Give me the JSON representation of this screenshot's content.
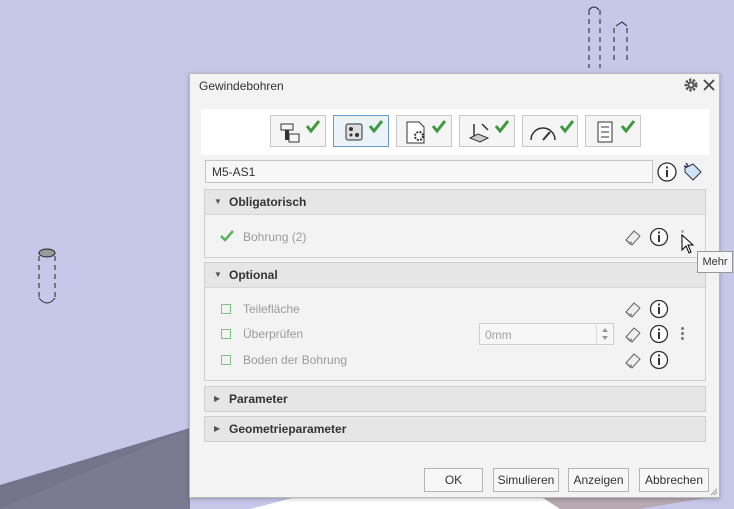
{
  "dialog": {
    "title": "Gewindebohren",
    "name_value": "M5-AS1"
  },
  "toolbar": {
    "tools": [
      {
        "icon": "tool-holder-icon",
        "checked": true
      },
      {
        "icon": "selection-icon",
        "checked": true
      },
      {
        "icon": "settings-page-icon",
        "checked": true
      },
      {
        "icon": "toolpath-icon",
        "checked": true
      },
      {
        "icon": "gauge-icon",
        "checked": true
      },
      {
        "icon": "list-icon",
        "checked": true
      }
    ],
    "active_index": 1
  },
  "sections": {
    "obligatorisch": {
      "label": "Obligatorisch",
      "rows": [
        {
          "label": "Bohrung (2)"
        }
      ]
    },
    "optional": {
      "label": "Optional",
      "rows": [
        {
          "label": "Teilefläche"
        },
        {
          "label": "Überprüfen",
          "value": "0mm"
        },
        {
          "label": "Boden der Bohrung"
        }
      ]
    },
    "parameter": {
      "label": "Parameter"
    },
    "geometrie": {
      "label": "Geometrieparameter"
    }
  },
  "buttons": {
    "ok": "OK",
    "simulate": "Simulieren",
    "show": "Anzeigen",
    "cancel": "Abbrechen"
  },
  "tooltip": "Mehr",
  "colors": {
    "background": "#c7c7ea",
    "check": "#3f9a3f",
    "floor": "#77778f"
  }
}
